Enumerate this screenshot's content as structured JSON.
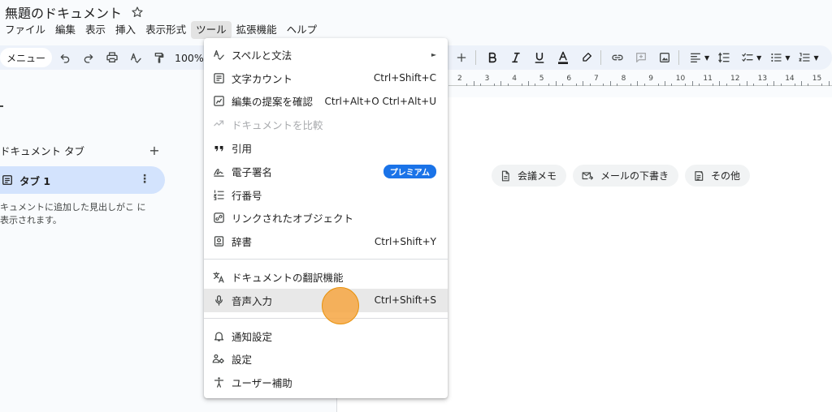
{
  "document": {
    "title": "無題のドキュメント"
  },
  "menubar": [
    {
      "label": "ファイル",
      "active": false
    },
    {
      "label": "編集",
      "active": false
    },
    {
      "label": "表示",
      "active": false
    },
    {
      "label": "挿入",
      "active": false
    },
    {
      "label": "表示形式",
      "active": false
    },
    {
      "label": "ツール",
      "active": true
    },
    {
      "label": "拡張機能",
      "active": false
    },
    {
      "label": "ヘルプ",
      "active": false
    }
  ],
  "toolbar": {
    "menu_label": "メニュー",
    "zoom": "100%"
  },
  "ruler": {
    "numbers": [
      "2",
      "3",
      "4",
      "5",
      "6",
      "7",
      "8",
      "9",
      "10",
      "11",
      "12",
      "13",
      "14",
      "15"
    ]
  },
  "sidebar": {
    "header": "ドキュメント タブ",
    "tab_label": "タブ 1",
    "hint": "キュメントに追加した見出しがこ に表示されます。"
  },
  "chips": [
    {
      "label": "会議メモ",
      "icon": "document-icon"
    },
    {
      "label": "メールの下書き",
      "icon": "email-draft-icon"
    },
    {
      "label": "その他",
      "icon": "more-templates-icon"
    }
  ],
  "tools_menu": {
    "items": [
      {
        "label": "スペルと文法",
        "icon": "spellcheck-icon",
        "shortcut": "",
        "submenu": true
      },
      {
        "label": "文字カウント",
        "icon": "word-count-icon",
        "shortcut": "Ctrl+Shift+C"
      },
      {
        "label": "編集の提案を確認",
        "icon": "review-suggestions-icon",
        "shortcut": "Ctrl+Alt+O Ctrl+Alt+U"
      },
      {
        "label": "ドキュメントを比較",
        "icon": "compare-icon",
        "shortcut": "",
        "disabled": true
      },
      {
        "label": "引用",
        "icon": "quote-icon",
        "shortcut": ""
      },
      {
        "label": "電子署名",
        "icon": "signature-icon",
        "badge": "プレミアム"
      },
      {
        "label": "行番号",
        "icon": "line-numbers-icon",
        "shortcut": ""
      },
      {
        "label": "リンクされたオブジェクト",
        "icon": "linked-objects-icon",
        "shortcut": ""
      },
      {
        "label": "辞書",
        "icon": "dictionary-icon",
        "shortcut": "Ctrl+Shift+Y"
      },
      {
        "label": "ドキュメントの翻訳機能",
        "icon": "translate-icon",
        "shortcut": ""
      },
      {
        "label": "音声入力",
        "icon": "microphone-icon",
        "shortcut": "Ctrl+Shift+S",
        "highlight": true
      },
      {
        "label": "通知設定",
        "icon": "bell-icon",
        "shortcut": ""
      },
      {
        "label": "設定",
        "icon": "preferences-icon",
        "shortcut": ""
      },
      {
        "label": "ユーザー補助",
        "icon": "accessibility-icon",
        "shortcut": ""
      }
    ]
  },
  "colors": {
    "accent": "#0b57d0",
    "premium_badge": "#1a73e8",
    "tab_selected_bg": "#d3e3fd",
    "toolbar_bg": "#edf2fa",
    "click_indicator": "#f6a642"
  }
}
